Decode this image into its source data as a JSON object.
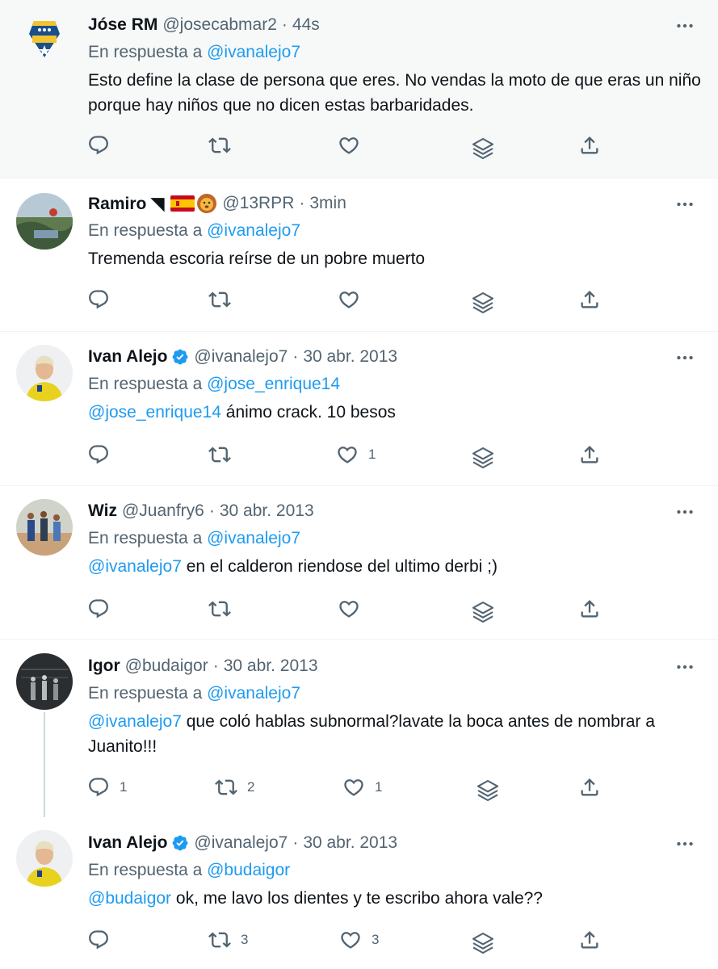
{
  "tweets": [
    {
      "name": "Jóse RM",
      "handle": "@josecabmar2",
      "time": "44s",
      "reply_label": "En respuesta a",
      "reply_to": "@ivanalejo7",
      "text": "Esto define la clase de persona que eres. No vendas la moto de que eras un niño porque hay niños que no dicen estas barbaridades.",
      "reply_count": "",
      "retweet_count": "",
      "like_count": ""
    },
    {
      "name": "Ramiro ◥",
      "handle": "@13RPR",
      "time": "3min",
      "reply_label": "En respuesta a",
      "reply_to": "@ivanalejo7",
      "text": "Tremenda escoria reírse de un pobre muerto",
      "reply_count": "",
      "retweet_count": "",
      "like_count": ""
    },
    {
      "name": "Ivan Alejo",
      "handle": "@ivanalejo7",
      "time": "30 abr. 2013",
      "reply_label": "En respuesta a",
      "reply_to": "@jose_enrique14",
      "text_mention": "@jose_enrique14",
      "text": "ánimo crack. 10 besos",
      "reply_count": "",
      "retweet_count": "",
      "like_count": "1"
    },
    {
      "name": "Wiz",
      "handle": "@Juanfry6",
      "time": "30 abr. 2013",
      "reply_label": "En respuesta a",
      "reply_to": "@ivanalejo7",
      "text_mention": "@ivanalejo7",
      "text": "en el calderon riendose del ultimo derbi ;)",
      "reply_count": "",
      "retweet_count": "",
      "like_count": ""
    },
    {
      "name": "Igor",
      "handle": "@budaigor",
      "time": "30 abr. 2013",
      "reply_label": "En respuesta a",
      "reply_to": "@ivanalejo7",
      "text_mention": "@ivanalejo7",
      "text": "que coló hablas subnormal?lavate la boca antes de nombrar a Juanito!!!",
      "reply_count": "1",
      "retweet_count": "2",
      "like_count": "1"
    },
    {
      "name": "Ivan Alejo",
      "handle": "@ivanalejo7",
      "time": "30 abr. 2013",
      "reply_label": "En respuesta a",
      "reply_to": "@budaigor",
      "text_mention": "@budaigor",
      "text": "ok, me lavo los dientes y te escribo ahora vale??",
      "reply_count": "",
      "retweet_count": "3",
      "like_count": "3"
    }
  ],
  "colors": {
    "accent": "#1d9bf0",
    "secondary_text": "#536471",
    "primary_text": "#0f1419",
    "highlight_bg": "#f7f9f9",
    "divider": "#eff3f4",
    "thread_line": "#cfd9de"
  },
  "icons": [
    "more-icon",
    "reply-icon",
    "retweet-icon",
    "like-icon",
    "analytics-icon",
    "share-icon",
    "verified-icon"
  ]
}
